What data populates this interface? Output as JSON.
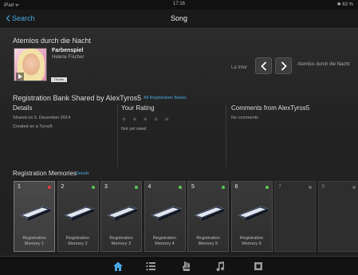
{
  "status_bar": {
    "left": "iPad ᯤ",
    "time": "17:16",
    "right": "✱ 63 %"
  },
  "nav": {
    "back_label": "Search",
    "title": "Song"
  },
  "song": {
    "title": "Atemlos durch die Nacht",
    "album_title": "Farbenspiel",
    "artist": "Helene Fischer",
    "badge": "iTunes",
    "la_inter": "La inter",
    "next_song": "Atemlos durch die Nacht"
  },
  "bank": {
    "title": "Registration Bank Shared by AlexTyros5",
    "link": "All Registration Banks"
  },
  "details": {
    "heading": "Details",
    "shared": "Shared on 5. Dezember 2014",
    "created": "Created on a Tyros5"
  },
  "rating": {
    "heading": "Your Rating",
    "stars": "★ ★ ★ ★ ★",
    "status": "Not yet rated"
  },
  "comments": {
    "heading": "Comments from AlexTyros5",
    "status": "No comments"
  },
  "memories": {
    "title": "Registration Memories",
    "link": "Details",
    "cards": [
      {
        "num": "1",
        "label": "Registration Memory 1",
        "dot": "#e03b3b",
        "filled": true,
        "active": true
      },
      {
        "num": "2",
        "label": "Registration Memory 2",
        "dot": "#5ac85a",
        "filled": true
      },
      {
        "num": "3",
        "label": "Registration Memory 3",
        "dot": "#5ac85a",
        "filled": true
      },
      {
        "num": "4",
        "label": "Registration Memory 4",
        "dot": "#5ac85a",
        "filled": true
      },
      {
        "num": "5",
        "label": "Registration Memory 5",
        "dot": "#5ac85a",
        "filled": true
      },
      {
        "num": "6",
        "label": "Registration Memory 6",
        "dot": "#5ac85a",
        "filled": true
      },
      {
        "num": "7",
        "label": "",
        "dot": "#666666",
        "filled": false
      },
      {
        "num": "8",
        "label": "",
        "dot": "#666666",
        "filled": false
      }
    ]
  },
  "tabs": [
    {
      "name": "home-icon",
      "active": true
    },
    {
      "name": "list-icon",
      "active": false
    },
    {
      "name": "keyboard-hand-icon",
      "active": false
    },
    {
      "name": "music-note-icon",
      "active": false
    },
    {
      "name": "settings-icon",
      "active": false
    }
  ],
  "colors": {
    "accent": "#4aa8e0",
    "active_tab": "#4aa8e0",
    "inactive_tab": "#9a9a9a"
  }
}
